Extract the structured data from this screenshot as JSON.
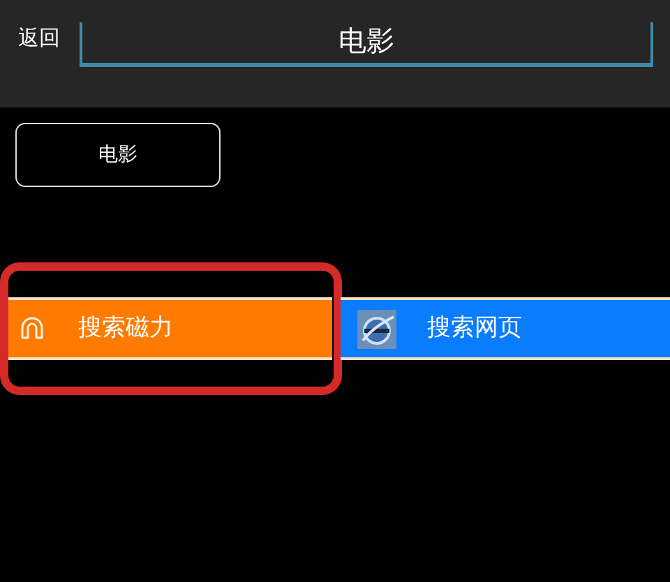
{
  "top_bar": {
    "back": "返回",
    "search": {
      "value": "电影"
    }
  },
  "keyword_button": "电影",
  "actions": [
    {
      "kind": "magnet",
      "label": "搜索磁力",
      "color": "#ff7a00",
      "highlighted": true
    },
    {
      "kind": "web",
      "label": "搜索网页",
      "color": "#0a7cff",
      "highlighted": false
    }
  ]
}
